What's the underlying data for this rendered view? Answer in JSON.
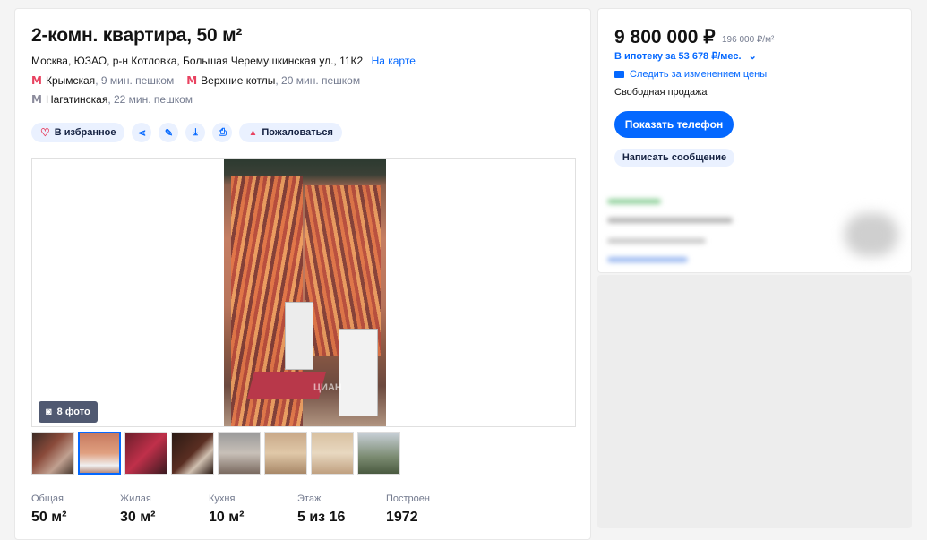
{
  "listing": {
    "title": "2-комн. квартира, 50 м²",
    "address": "Москва, ЮЗАО, р-н Котловка, Большая Черемушкинская ул., 11К2",
    "map_link": "На карте",
    "metro": [
      {
        "name": "Крымская",
        "distance": ", 9 мин. пешком",
        "color": "#e84260"
      },
      {
        "name": "Верхние котлы",
        "distance": ", 20 мин. пешком",
        "color": "#e84260"
      },
      {
        "name": "Нагатинская",
        "distance": ", 22 мин. пешком",
        "color": "#8c8c9c"
      }
    ],
    "actions": {
      "favorite": "В избранное",
      "complain": "Пожаловаться"
    },
    "photo_count": "8 фото",
    "watermark": "ЦИАН",
    "stats": [
      {
        "label": "Общая",
        "value": "50 м²"
      },
      {
        "label": "Жилая",
        "value": "30 м²"
      },
      {
        "label": "Кухня",
        "value": "10 м²"
      },
      {
        "label": "Этаж",
        "value": "5 из 16"
      },
      {
        "label": "Построен",
        "value": "1972"
      }
    ]
  },
  "sidebar": {
    "price": "9 800 000 ₽",
    "price_per_m2": "196 000 ₽/м²",
    "mortgage": "В ипотеку за 53 678 ₽/мес.",
    "track_price": "Следить за изменением цены",
    "sale_type": "Свободная продажа",
    "show_phone": "Показать телефон",
    "write_message": "Написать сообщение"
  },
  "colors": {
    "accent": "#0468ff",
    "metro_red": "#e84260",
    "metro_gray": "#8c8c9c"
  }
}
